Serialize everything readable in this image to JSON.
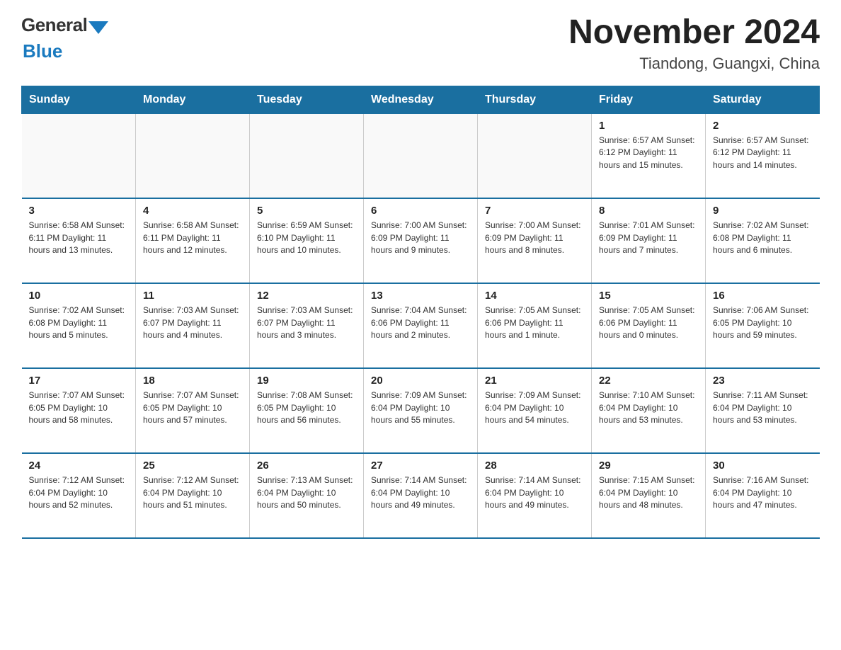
{
  "header": {
    "logo_general": "General",
    "logo_blue": "Blue",
    "month_year": "November 2024",
    "location": "Tiandong, Guangxi, China"
  },
  "weekdays": [
    "Sunday",
    "Monday",
    "Tuesday",
    "Wednesday",
    "Thursday",
    "Friday",
    "Saturday"
  ],
  "rows": [
    [
      {
        "day": "",
        "info": ""
      },
      {
        "day": "",
        "info": ""
      },
      {
        "day": "",
        "info": ""
      },
      {
        "day": "",
        "info": ""
      },
      {
        "day": "",
        "info": ""
      },
      {
        "day": "1",
        "info": "Sunrise: 6:57 AM\nSunset: 6:12 PM\nDaylight: 11 hours\nand 15 minutes."
      },
      {
        "day": "2",
        "info": "Sunrise: 6:57 AM\nSunset: 6:12 PM\nDaylight: 11 hours\nand 14 minutes."
      }
    ],
    [
      {
        "day": "3",
        "info": "Sunrise: 6:58 AM\nSunset: 6:11 PM\nDaylight: 11 hours\nand 13 minutes."
      },
      {
        "day": "4",
        "info": "Sunrise: 6:58 AM\nSunset: 6:11 PM\nDaylight: 11 hours\nand 12 minutes."
      },
      {
        "day": "5",
        "info": "Sunrise: 6:59 AM\nSunset: 6:10 PM\nDaylight: 11 hours\nand 10 minutes."
      },
      {
        "day": "6",
        "info": "Sunrise: 7:00 AM\nSunset: 6:09 PM\nDaylight: 11 hours\nand 9 minutes."
      },
      {
        "day": "7",
        "info": "Sunrise: 7:00 AM\nSunset: 6:09 PM\nDaylight: 11 hours\nand 8 minutes."
      },
      {
        "day": "8",
        "info": "Sunrise: 7:01 AM\nSunset: 6:09 PM\nDaylight: 11 hours\nand 7 minutes."
      },
      {
        "day": "9",
        "info": "Sunrise: 7:02 AM\nSunset: 6:08 PM\nDaylight: 11 hours\nand 6 minutes."
      }
    ],
    [
      {
        "day": "10",
        "info": "Sunrise: 7:02 AM\nSunset: 6:08 PM\nDaylight: 11 hours\nand 5 minutes."
      },
      {
        "day": "11",
        "info": "Sunrise: 7:03 AM\nSunset: 6:07 PM\nDaylight: 11 hours\nand 4 minutes."
      },
      {
        "day": "12",
        "info": "Sunrise: 7:03 AM\nSunset: 6:07 PM\nDaylight: 11 hours\nand 3 minutes."
      },
      {
        "day": "13",
        "info": "Sunrise: 7:04 AM\nSunset: 6:06 PM\nDaylight: 11 hours\nand 2 minutes."
      },
      {
        "day": "14",
        "info": "Sunrise: 7:05 AM\nSunset: 6:06 PM\nDaylight: 11 hours\nand 1 minute."
      },
      {
        "day": "15",
        "info": "Sunrise: 7:05 AM\nSunset: 6:06 PM\nDaylight: 11 hours\nand 0 minutes."
      },
      {
        "day": "16",
        "info": "Sunrise: 7:06 AM\nSunset: 6:05 PM\nDaylight: 10 hours\nand 59 minutes."
      }
    ],
    [
      {
        "day": "17",
        "info": "Sunrise: 7:07 AM\nSunset: 6:05 PM\nDaylight: 10 hours\nand 58 minutes."
      },
      {
        "day": "18",
        "info": "Sunrise: 7:07 AM\nSunset: 6:05 PM\nDaylight: 10 hours\nand 57 minutes."
      },
      {
        "day": "19",
        "info": "Sunrise: 7:08 AM\nSunset: 6:05 PM\nDaylight: 10 hours\nand 56 minutes."
      },
      {
        "day": "20",
        "info": "Sunrise: 7:09 AM\nSunset: 6:04 PM\nDaylight: 10 hours\nand 55 minutes."
      },
      {
        "day": "21",
        "info": "Sunrise: 7:09 AM\nSunset: 6:04 PM\nDaylight: 10 hours\nand 54 minutes."
      },
      {
        "day": "22",
        "info": "Sunrise: 7:10 AM\nSunset: 6:04 PM\nDaylight: 10 hours\nand 53 minutes."
      },
      {
        "day": "23",
        "info": "Sunrise: 7:11 AM\nSunset: 6:04 PM\nDaylight: 10 hours\nand 53 minutes."
      }
    ],
    [
      {
        "day": "24",
        "info": "Sunrise: 7:12 AM\nSunset: 6:04 PM\nDaylight: 10 hours\nand 52 minutes."
      },
      {
        "day": "25",
        "info": "Sunrise: 7:12 AM\nSunset: 6:04 PM\nDaylight: 10 hours\nand 51 minutes."
      },
      {
        "day": "26",
        "info": "Sunrise: 7:13 AM\nSunset: 6:04 PM\nDaylight: 10 hours\nand 50 minutes."
      },
      {
        "day": "27",
        "info": "Sunrise: 7:14 AM\nSunset: 6:04 PM\nDaylight: 10 hours\nand 49 minutes."
      },
      {
        "day": "28",
        "info": "Sunrise: 7:14 AM\nSunset: 6:04 PM\nDaylight: 10 hours\nand 49 minutes."
      },
      {
        "day": "29",
        "info": "Sunrise: 7:15 AM\nSunset: 6:04 PM\nDaylight: 10 hours\nand 48 minutes."
      },
      {
        "day": "30",
        "info": "Sunrise: 7:16 AM\nSunset: 6:04 PM\nDaylight: 10 hours\nand 47 minutes."
      }
    ]
  ]
}
